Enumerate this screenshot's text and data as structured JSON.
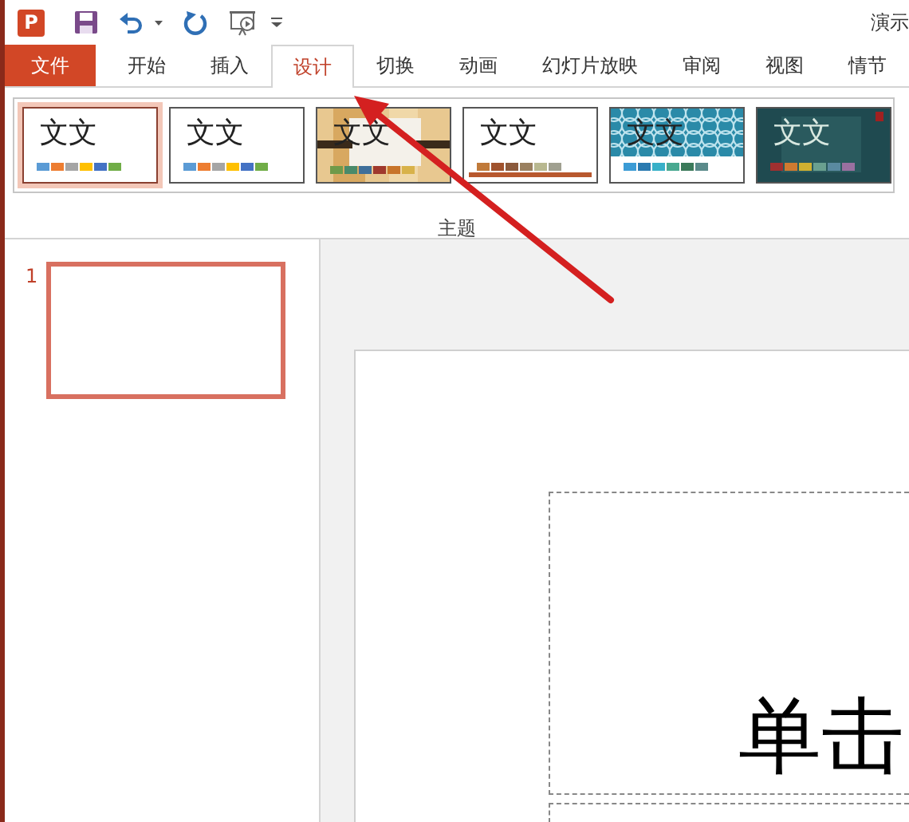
{
  "window": {
    "app_logo": "P",
    "title": "演示"
  },
  "tabs": [
    {
      "label": "文件",
      "kind": "file",
      "selected": false
    },
    {
      "label": "开始",
      "kind": "tab",
      "selected": false
    },
    {
      "label": "插入",
      "kind": "tab",
      "selected": false
    },
    {
      "label": "设计",
      "kind": "tab",
      "selected": true
    },
    {
      "label": "切换",
      "kind": "tab",
      "selected": false
    },
    {
      "label": "动画",
      "kind": "tab",
      "selected": false
    },
    {
      "label": "幻灯片放映",
      "kind": "tab",
      "selected": false
    },
    {
      "label": "审阅",
      "kind": "tab",
      "selected": false
    },
    {
      "label": "视图",
      "kind": "tab",
      "selected": false
    },
    {
      "label": "情节",
      "kind": "tab",
      "selected": false
    }
  ],
  "themes": {
    "label": "主题",
    "items": [
      {
        "sample": "文文",
        "kind": "plain",
        "selected": true,
        "swatches": [
          {
            "color": "#5b9bd5"
          },
          {
            "color": "#ed7d31"
          },
          {
            "color": "#a5a5a5"
          },
          {
            "color": "#ffc000"
          },
          {
            "color": "#4472c4"
          },
          {
            "color": "#70ad47"
          }
        ]
      },
      {
        "sample": "文文",
        "kind": "plain",
        "selected": false,
        "swatches": [
          {
            "color": "#5b9bd5"
          },
          {
            "color": "#ed7d31"
          },
          {
            "color": "#a5a5a5"
          },
          {
            "color": "#ffc000"
          },
          {
            "color": "#4472c4"
          },
          {
            "color": "#70ad47"
          }
        ]
      },
      {
        "sample": "文文",
        "kind": "wood",
        "selected": false,
        "swatches": [
          {
            "color": "#6f9a4a"
          },
          {
            "color": "#4a8a6a"
          },
          {
            "color": "#3f6f9a"
          },
          {
            "color": "#a0392d"
          },
          {
            "color": "#c8752a"
          },
          {
            "color": "#d8b24a"
          }
        ]
      },
      {
        "sample": "文文",
        "kind": "bottom-band",
        "selected": false,
        "swatches": [
          {
            "color": "#c07a3a"
          },
          {
            "color": "#a0522d"
          },
          {
            "color": "#8b5a3c"
          },
          {
            "color": "#9a8060"
          },
          {
            "color": "#b8b890"
          },
          {
            "color": "#a0a090"
          }
        ]
      },
      {
        "sample": "文文",
        "kind": "pattern",
        "selected": false,
        "swatches": [
          {
            "color": "#3b9bd5"
          },
          {
            "color": "#2a7ab0"
          },
          {
            "color": "#38b0c8"
          },
          {
            "color": "#48a890"
          },
          {
            "color": "#3b7a5a"
          },
          {
            "color": "#5a8a8a"
          }
        ]
      },
      {
        "sample": "文文",
        "kind": "dark",
        "selected": false,
        "swatches": [
          {
            "color": "#a03030"
          },
          {
            "color": "#d07a30"
          },
          {
            "color": "#d0b030"
          },
          {
            "color": "#6aa090"
          },
          {
            "color": "#5a8aa0"
          },
          {
            "color": "#9a70a0"
          }
        ]
      }
    ]
  },
  "slides_pane": {
    "items": [
      {
        "number": "1",
        "selected": true
      }
    ]
  },
  "slide": {
    "title_placeholder": "单击"
  }
}
